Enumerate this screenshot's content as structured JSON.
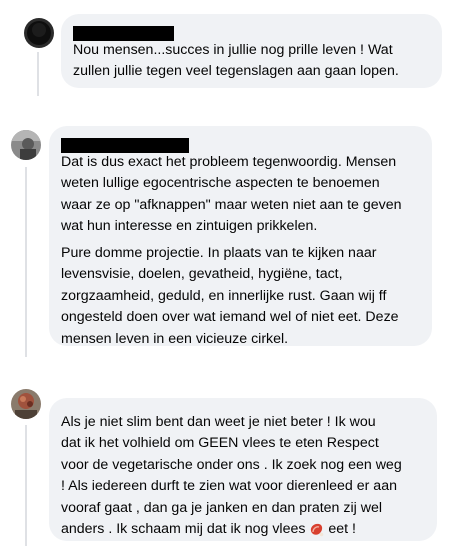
{
  "comments": [
    {
      "avatar_icon": "profile-photo-dark",
      "author": "",
      "paragraphs": [
        "Nou mensen...succes in jullie nog prille leven ! Wat\nzullen jullie tegen veel tegenslagen aan gaan lopen."
      ]
    },
    {
      "avatar_icon": "profile-photo-gray",
      "author": "",
      "paragraphs": [
        "Dat is dus exact het probleem tegenwoordig. Mensen\nweten lullige egocentrische aspecten te benoemen\nwaar ze op \"afknappen\" maar weten niet aan te geven\nwat hun interesse en zintuigen prikkelen.",
        "Pure domme projectie. In plaats van te kijken naar\nlevensvisie, doelen, gevatheid, hygiëne, tact,\nzorgzaamheid, geduld, en innerlijke rust. Gaan wij ff\nongesteld doen over wat iemand wel of niet eet. Deze\nmensen leven in een vicieuze cirkel."
      ]
    },
    {
      "avatar_icon": "profile-photo-brown",
      "author": "",
      "paragraphs": [
        "Als je niet slim bent dan weet je niet beter ! Ik wou\ndat ik het volhield om GEEN vlees te eten Respect\nvoor de vegetarische onder ons . Ik zoek nog een weg\n! Als iedereen durft te zien wat voor dierenleed er aan\nvooraf gaat , dan ga je janken en dan praten zij wel"
      ],
      "last_line_before_emoji": "anders . Ik schaam mij dat ik nog vlees ",
      "emoji_icon": "meat-emoji",
      "last_line_after_emoji": " eet !"
    }
  ]
}
